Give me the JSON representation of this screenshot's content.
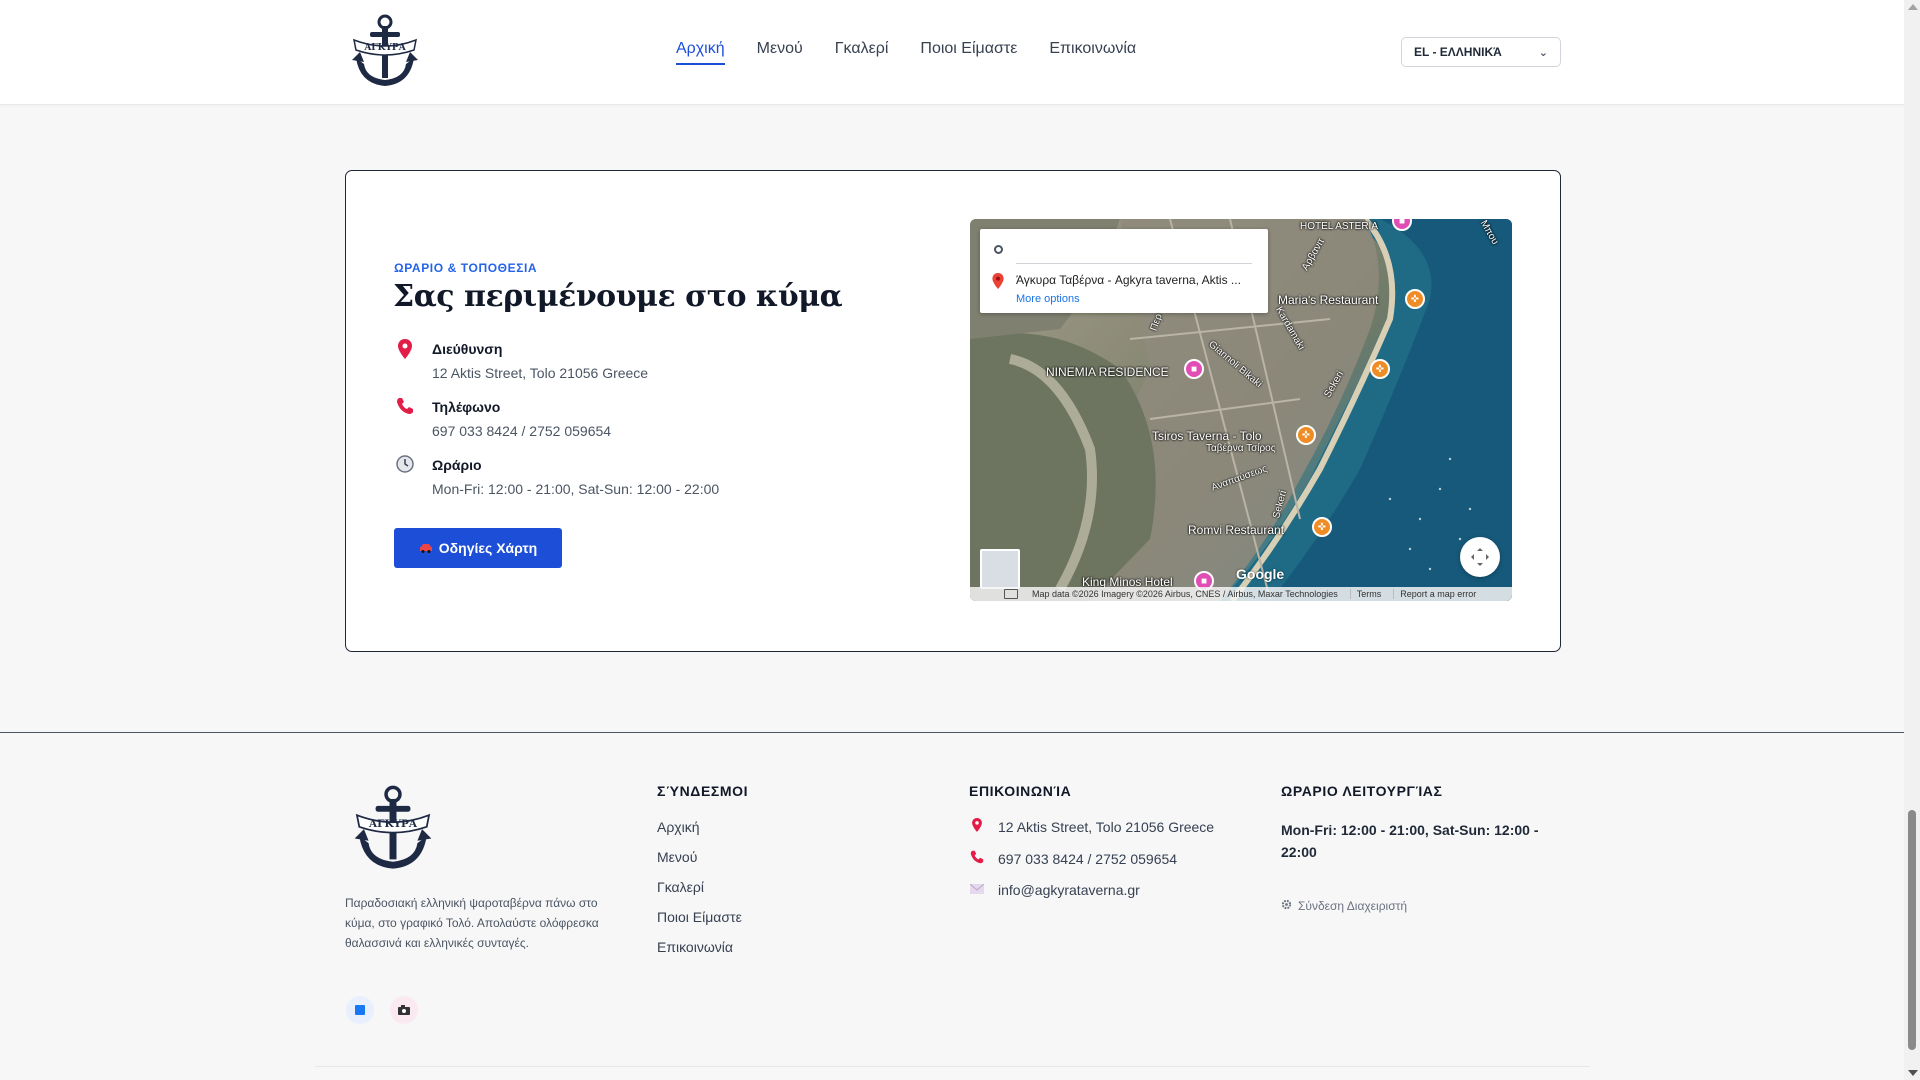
{
  "brand": {
    "logo_text": "ΑΓΚΥΡΑ"
  },
  "nav": {
    "items": [
      {
        "label": "Αρχική",
        "active": true
      },
      {
        "label": "Μενού",
        "active": false
      },
      {
        "label": "Γκαλερί",
        "active": false
      },
      {
        "label": "Ποιοι Είμαστε",
        "active": false
      },
      {
        "label": "Επικοινωνία",
        "active": false
      }
    ]
  },
  "language": {
    "selected": "EL - ΕΛΛΗΝΙΚΆ"
  },
  "location": {
    "eyebrow": "ΩΡΑΡΙΟ & ΤΟΠΟΘΕΣΙΑ",
    "heading": "Σας περιμένουμε στο κύμα",
    "address": {
      "label": "Διεύθυνση",
      "value": "12 Aktis Street, Tolo 21056 Greece"
    },
    "phone": {
      "label": "Τηλέφωνο",
      "value": "697 033 8424 / 2752 059654"
    },
    "hours": {
      "label": "Ωράριο",
      "value": "Mon-Fri: 12:00 - 21:00, Sat-Sun: 12:00 - 22:00"
    },
    "directions_button": "Οδηγίες Χάρτη"
  },
  "map": {
    "destination": "Άγκυρα Ταβέρνα - Agkyra taverna, Aktis ...",
    "more_options": "More options",
    "labels": {
      "marias": "Maria's Restaurant",
      "ninemia": "NINEMIA RESIDENCE",
      "tsiros": "Tsiros Taverna - Tolo",
      "tsiros_gr": "Ταβέρνα Τσίρος",
      "romvi": "Romvi Restaurant",
      "kingminos": "King Minos Hotel",
      "hotel_asteria": "HOTEL ASTERIA",
      "giannoli": "Giannoli Bikaki",
      "sekeri": "Sekeri",
      "sekeri2": "Sekeri",
      "kardamaki": "Kardamaki",
      "anapafseos": "Αναπαύσεως",
      "perigiali": "Περ",
      "mpouk": "Μπου",
      "arvanito": "Αρβανιτ"
    },
    "google": "Google",
    "footer": {
      "data": "Map data ©2026 Imagery ©2026 Airbus, CNES / Airbus, Maxar Technologies",
      "terms": "Terms",
      "report": "Report a map error"
    }
  },
  "footer": {
    "description": "Παραδοσιακή ελληνική ψαροταβέρνα πάνω στο κύμα, στο γραφικό Τολό. Απολαύστε ολόφρεσκα θαλασσινά και ελληνικές συνταγές.",
    "links_title": "ΣΎΝΔΕΣΜΟΙ",
    "links": [
      "Αρχική",
      "Μενού",
      "Γκαλερί",
      "Ποιοι Είμαστε",
      "Επικοινωνία"
    ],
    "contact_title": "ΕΠΙΚΟΙΝΩΝΊΑ",
    "contact": {
      "address": "12 Aktis Street, Tolo 21056 Greece",
      "phone": "697 033 8424 / 2752 059654",
      "email": "info@agkyrataverna.gr"
    },
    "hours_title": "ΩΡΑΡΙΟ ΛΕΙΤΟΥΡΓΊΑΣ",
    "hours": "Mon-Fri: 12:00 - 21:00, Sat-Sun: 12:00 - 22:00",
    "admin_login": "Σύνδεση Διαχειριστή"
  },
  "colors": {
    "accent": "#1d4ed8",
    "pin": "#e11d48",
    "text": "#1f2937"
  }
}
